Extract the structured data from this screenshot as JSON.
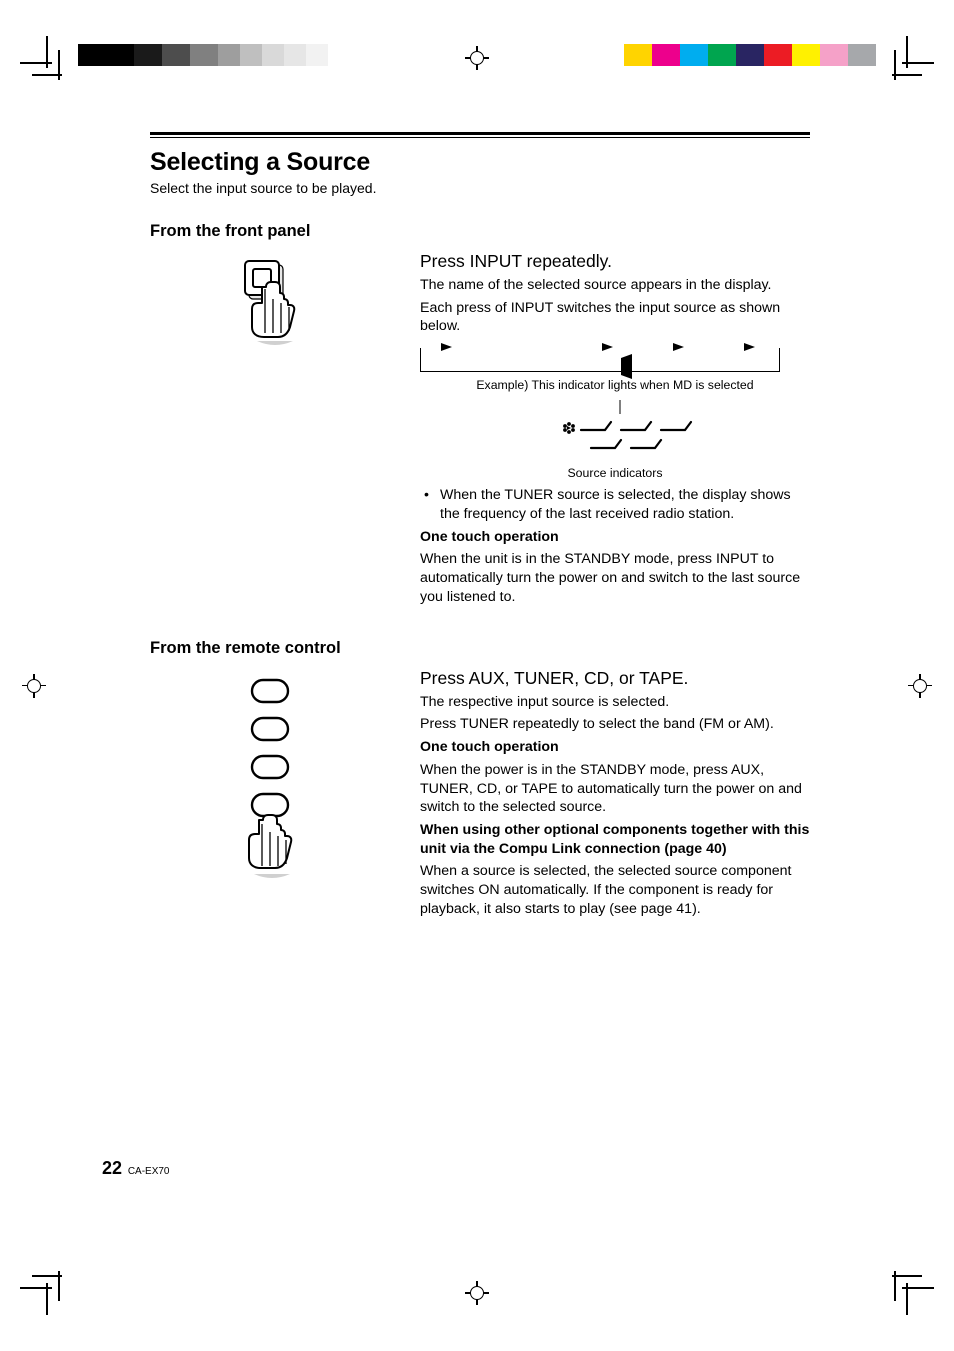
{
  "page": {
    "title": "Selecting a Source",
    "lead": "Select the input source to be played.",
    "number": "22",
    "model": "CA-EX70"
  },
  "front_panel": {
    "heading": "From the front panel",
    "instruction": "Press INPUT repeatedly.",
    "desc1": "The name of the selected source appears in the display.",
    "desc2": "Each press of INPUT switches the input source as shown below.",
    "example_caption": "Example) This indicator lights when MD is selected",
    "indicators_caption": "Source indicators",
    "bullet": "When the TUNER source is selected, the display shows the frequency of the last received radio station.",
    "one_touch_heading": "One touch operation",
    "one_touch_body": "When the unit is in the STANDBY mode, press INPUT to automatically turn the power on and switch to the last source you listened to."
  },
  "remote_control": {
    "heading": "From the remote control",
    "instruction": "Press AUX, TUNER, CD, or TAPE.",
    "desc1": "The respective input source is selected.",
    "desc2": "Press TUNER repeatedly to select the band (FM or AM).",
    "one_touch_heading": "One touch operation",
    "one_touch_body": "When the power is in the STANDBY mode, press AUX, TUNER, CD, or TAPE to automatically turn the power on and switch to the selected source.",
    "compu_link_heading": "When using other optional components together with this unit via the Compu Link connection (page 40)",
    "compu_link_body": "When a source is selected, the selected source component switches ON automatically. If the component is ready for playback, it also starts to play (see page 41)."
  },
  "colors": {
    "gray_swatches": [
      "#000000",
      "#000000",
      "#1a1a1a",
      "#4d4d4d",
      "#808080",
      "#9e9e9e",
      "#bfbfbf",
      "#d9d9d9",
      "#e6e6e6",
      "#f2f2f2"
    ],
    "color_swatches": [
      "#ffd400",
      "#ed008c",
      "#00adef",
      "#00a54f",
      "#292562",
      "#ec1c24",
      "#fff100",
      "#f5a1c8",
      "#a6a8ab"
    ]
  }
}
